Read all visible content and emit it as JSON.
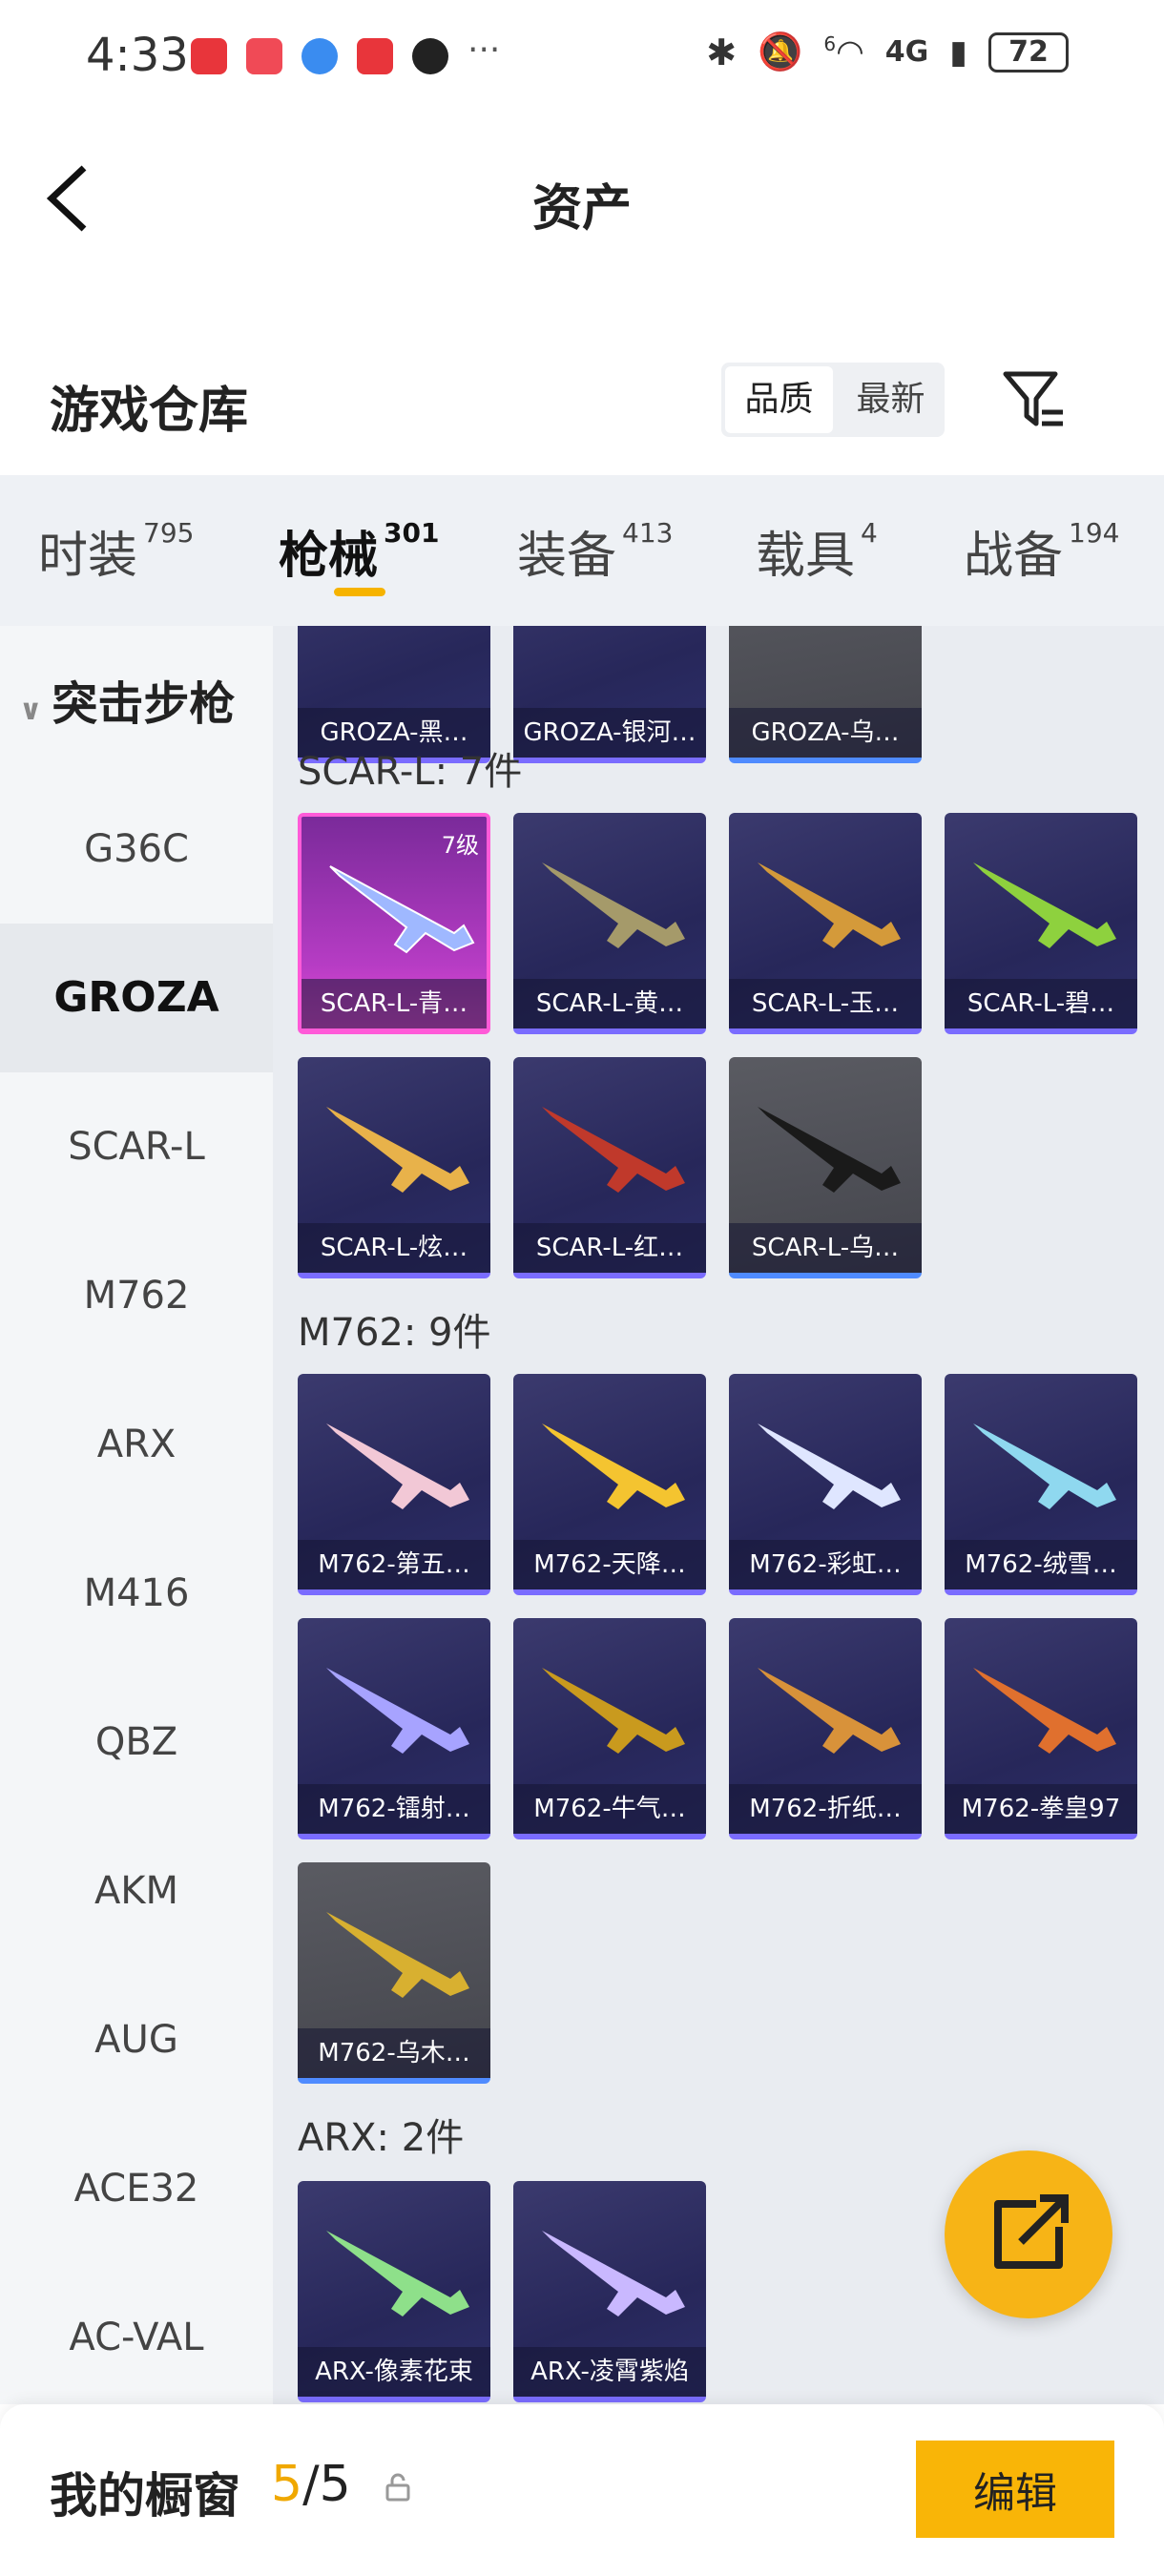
{
  "status": {
    "time": "4:33",
    "net": "4G",
    "battery": "72",
    "more": "···",
    "wifi_sup": "6"
  },
  "header": {
    "title": "资产"
  },
  "warehouse": {
    "title": "游戏仓库",
    "sort_options": [
      "品质",
      "最新"
    ]
  },
  "tabs": [
    {
      "label": "时装",
      "count": "795"
    },
    {
      "label": "枪械",
      "count": "301"
    },
    {
      "label": "装备",
      "count": "413"
    },
    {
      "label": "载具",
      "count": "4"
    },
    {
      "label": "战备",
      "count": "194"
    }
  ],
  "sidebar": {
    "group": "突击步枪",
    "items": [
      "G36C",
      "GROZA",
      "SCAR-L",
      "M762",
      "ARX",
      "M416",
      "QBZ",
      "AKM",
      "AUG",
      "ACE32",
      "AC-VAL"
    ]
  },
  "sections": [
    {
      "title": "",
      "items": [
        "GROZA-黑…",
        "GROZA-银河…",
        "GROZA-乌…"
      ]
    },
    {
      "title": "SCAR-L: 7件",
      "items": [
        "SCAR-L-青…",
        "SCAR-L-黄…",
        "SCAR-L-玉…",
        "SCAR-L-碧…",
        "SCAR-L-炫…",
        "SCAR-L-红…",
        "SCAR-L-乌…"
      ],
      "first_level": "7级"
    },
    {
      "title": "M762: 9件",
      "items": [
        "M762-第五…",
        "M762-天降…",
        "M762-彩虹…",
        "M762-绒雪…",
        "M762-镭射…",
        "M762-牛气…",
        "M762-折纸…",
        "M762-拳皇97",
        "M762-乌木…"
      ]
    },
    {
      "title": "ARX: 2件",
      "items": [
        "ARX-像素花束",
        "ARX-凌霄紫焰"
      ]
    }
  ],
  "bottom": {
    "title": "我的橱窗",
    "count_current": "5",
    "count_sep": "/",
    "count_total": "5",
    "edit_label": "编辑"
  },
  "colors": {
    "accent": "#f9b507",
    "card_bg": "#2d2f6a",
    "card_pink": "#e94dd6",
    "card_grey": "#4a4b52"
  }
}
